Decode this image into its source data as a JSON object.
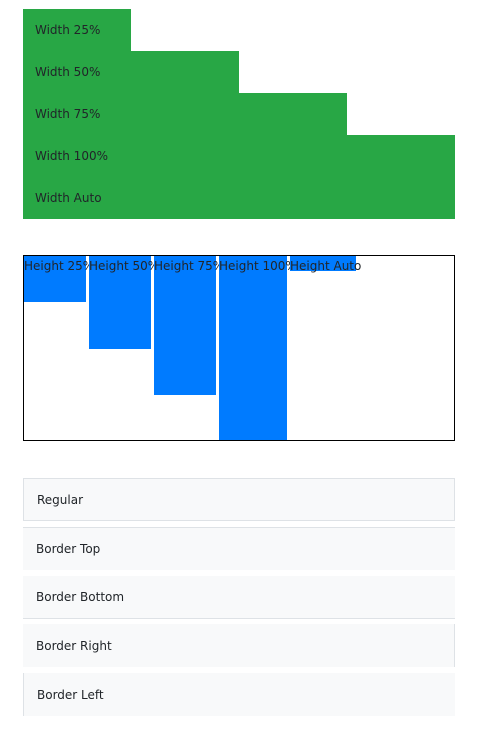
{
  "colors": {
    "width_bar": "#28a745",
    "height_bar": "#007bff",
    "border_item_bg": "#f8f9fa",
    "border_line": "#dee2e6",
    "height_container_border": "#000000"
  },
  "width_section": {
    "items": [
      {
        "label": "Width 25%"
      },
      {
        "label": "Width 50%"
      },
      {
        "label": "Width 75%"
      },
      {
        "label": "Width 100%"
      },
      {
        "label": "Width Auto"
      }
    ]
  },
  "height_section": {
    "items": [
      {
        "label": "Height 25%"
      },
      {
        "label": "Height 50%"
      },
      {
        "label": "Height 75%"
      },
      {
        "label": "Height 100%"
      },
      {
        "label": "Height Auto"
      }
    ]
  },
  "border_section": {
    "items": [
      {
        "label": "Regular"
      },
      {
        "label": "Border Top"
      },
      {
        "label": "Border Bottom"
      },
      {
        "label": "Border Right"
      },
      {
        "label": "Border Left"
      }
    ]
  }
}
